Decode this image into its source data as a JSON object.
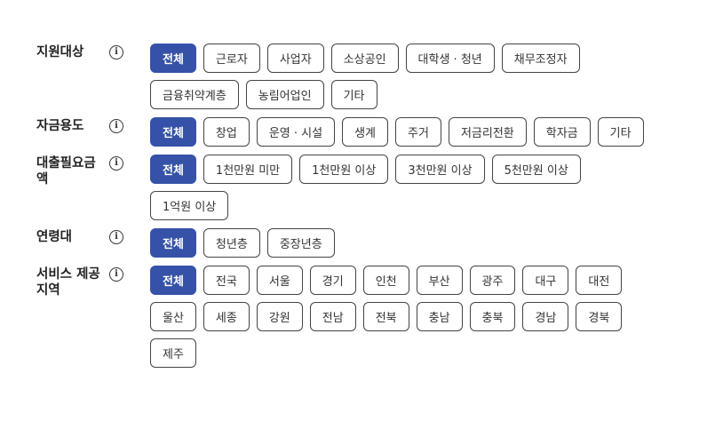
{
  "filters": [
    {
      "label": "지원대상",
      "options": [
        "전체",
        "근로자",
        "사업자",
        "소상공인",
        "대학생 · 청년",
        "채무조정자",
        "금융취약계층",
        "농림어업인",
        "기타"
      ],
      "selected": 0
    },
    {
      "label": "자금용도",
      "options": [
        "전체",
        "창업",
        "운영 · 시설",
        "생계",
        "주거",
        "저금리전환",
        "학자금",
        "기타"
      ],
      "selected": 0
    },
    {
      "label": "대출필요금액",
      "options": [
        "전체",
        "1천만원 미만",
        "1천만원 이상",
        "3천만원 이상",
        "5천만원 이상",
        "1억원 이상"
      ],
      "selected": 0
    },
    {
      "label": "연령대",
      "options": [
        "전체",
        "청년층",
        "중장년층"
      ],
      "selected": 0
    },
    {
      "label": "서비스 제공지역",
      "options": [
        "전체",
        "전국",
        "서울",
        "경기",
        "인천",
        "부산",
        "광주",
        "대구",
        "대전",
        "울산",
        "세종",
        "강원",
        "전남",
        "전북",
        "충남",
        "충북",
        "경남",
        "경북",
        "제주"
      ],
      "selected": 0
    }
  ],
  "info_icon_glyph": "i",
  "colors": {
    "active_bg": "#3552a8",
    "chip_border": "#444444"
  }
}
